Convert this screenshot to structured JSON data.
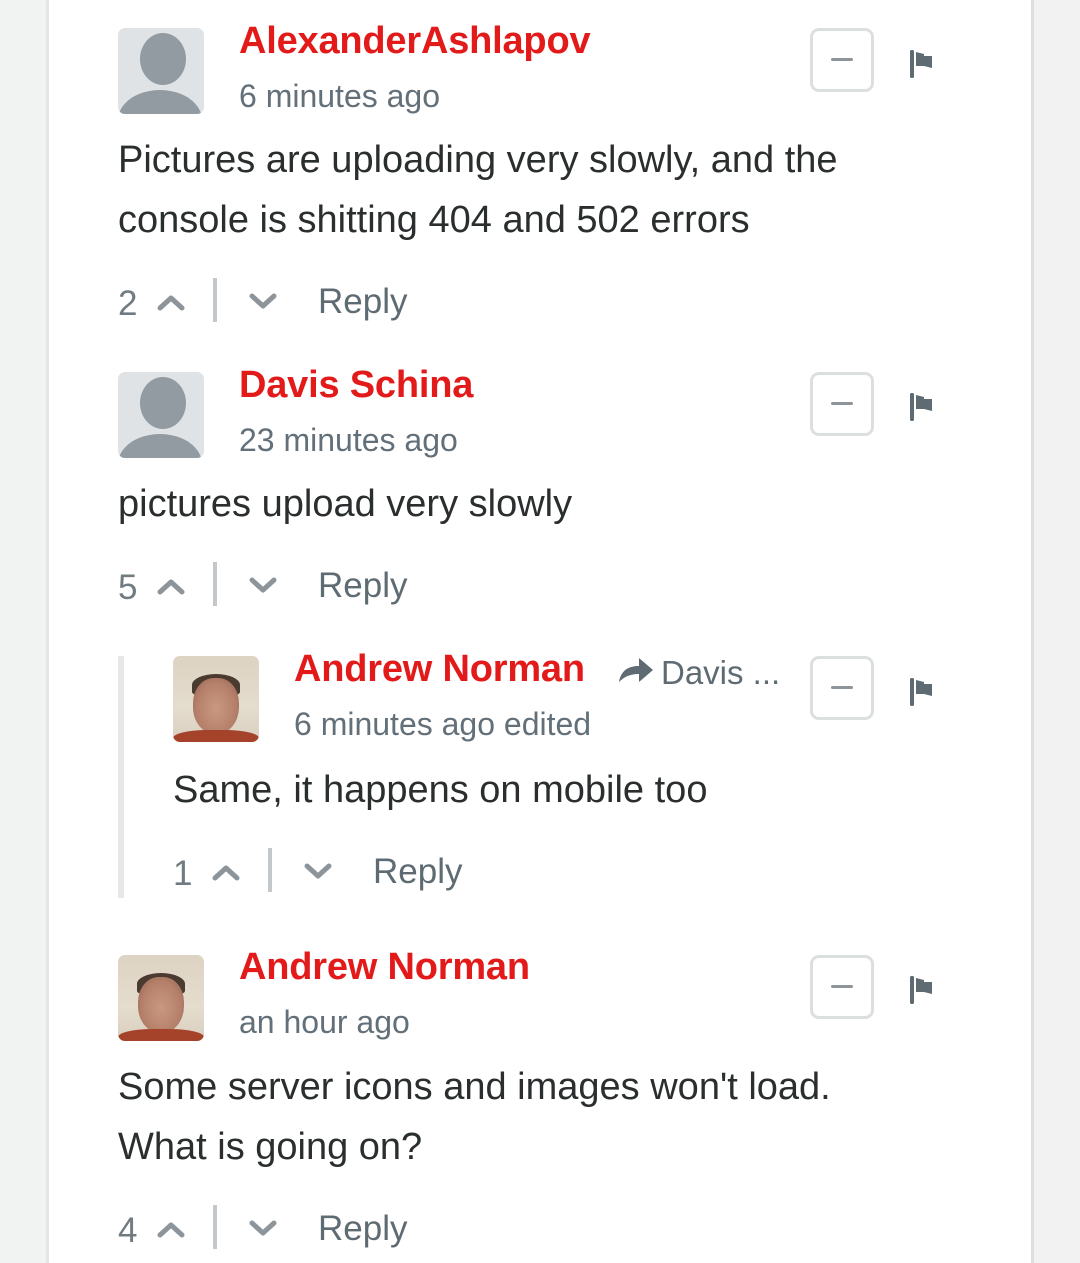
{
  "colors": {
    "author": "#e31a1a",
    "meta": "#637079",
    "text": "#2a2e2e",
    "icon": "#5f6b72"
  },
  "comments": [
    {
      "author": "AlexanderAshlapov",
      "avatar": "default-avatar-icon",
      "timestamp": "6 minutes ago",
      "body_lines": [
        "Pictures are uploading very slowly, and the",
        "console is shitting 404 and 502 errors"
      ],
      "votes": "2",
      "reply_label": "Reply",
      "collapse_label": "−",
      "flag_icon": "flag-icon"
    },
    {
      "author": "Davis Schina",
      "avatar": "default-avatar-icon",
      "timestamp": "23 minutes ago",
      "body_lines": [
        "pictures upload very slowly"
      ],
      "votes": "5",
      "reply_label": "Reply",
      "collapse_label": "−",
      "flag_icon": "flag-icon"
    },
    {
      "author": "Andrew Norman",
      "avatar": "user-photo",
      "reply_to": "Davis ...",
      "timestamp": "6 minutes ago edited",
      "body_lines": [
        "Same, it happens on mobile too"
      ],
      "votes": "1",
      "reply_label": "Reply",
      "collapse_label": "−",
      "flag_icon": "flag-icon",
      "nested": true
    },
    {
      "author": "Andrew Norman",
      "avatar": "user-photo",
      "timestamp": "an hour ago",
      "body_lines": [
        "Some server icons and images won't load.",
        "What is going on?"
      ],
      "votes": "4",
      "reply_label": "Reply",
      "collapse_label": "−",
      "flag_icon": "flag-icon"
    }
  ]
}
